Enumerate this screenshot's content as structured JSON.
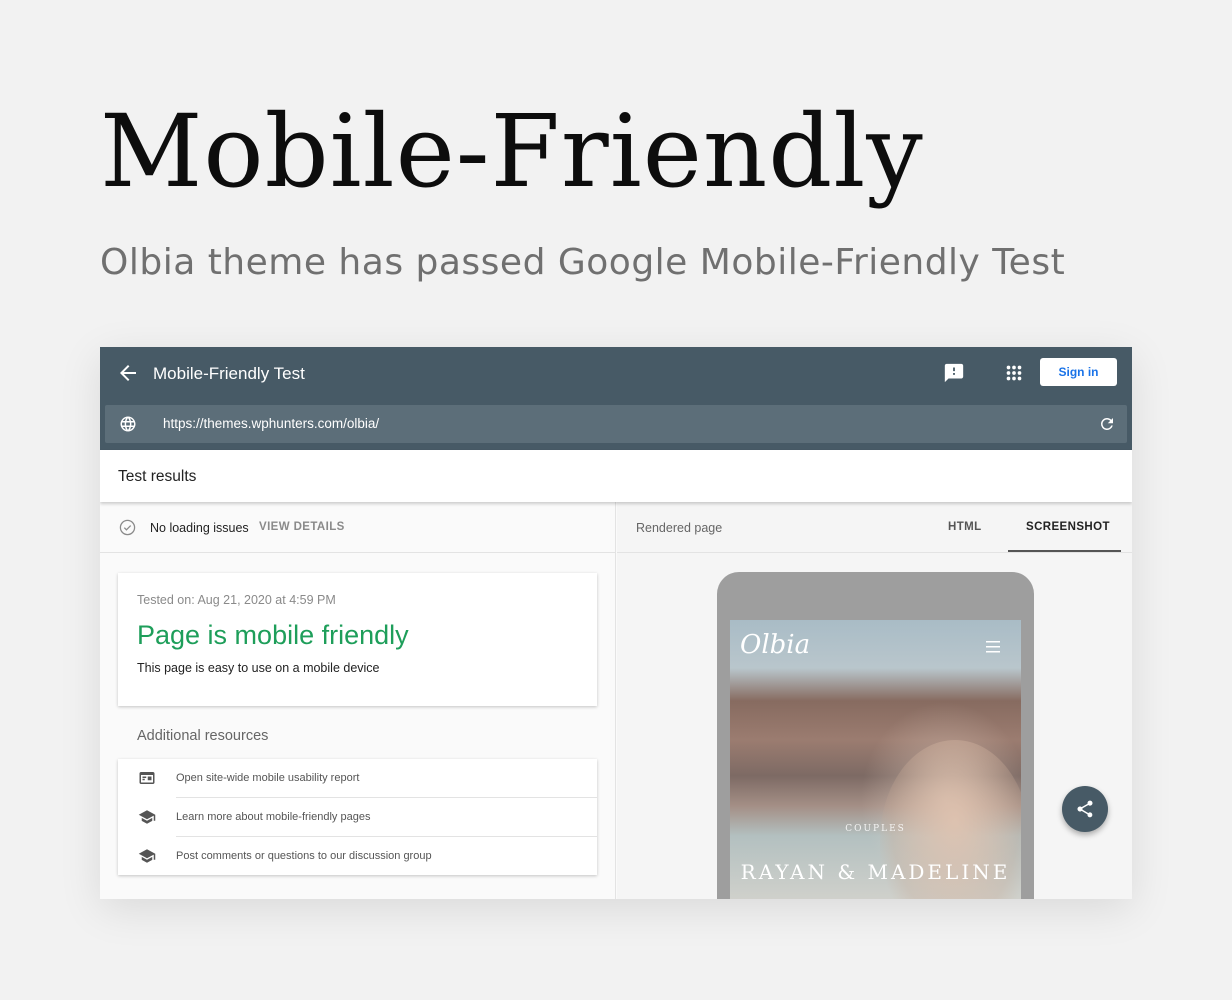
{
  "hero": {
    "title": "Mobile-Friendly",
    "subtitle": "Olbia theme has passed Google Mobile-Friendly Test"
  },
  "appbar": {
    "title": "Mobile-Friendly Test",
    "signin_label": "Sign in",
    "url": "https://themes.wphunters.com/olbia/"
  },
  "results": {
    "title": "Test results",
    "status": "No loading issues",
    "view_details": "VIEW DETAILS",
    "tested_on": "Tested on: Aug 21, 2020 at 4:59 PM",
    "verdict": "Page is mobile friendly",
    "verdict_desc": "This page is easy to use on a mobile device",
    "verdict_color": "#1e9e5a"
  },
  "resources": {
    "title": "Additional resources",
    "items": [
      {
        "label": "Open site-wide mobile usability report",
        "icon": "report-icon"
      },
      {
        "label": "Learn more about mobile-friendly pages",
        "icon": "school-icon"
      },
      {
        "label": "Post comments or questions to our discussion group",
        "icon": "school-icon"
      }
    ]
  },
  "rendered": {
    "label": "Rendered page",
    "tabs": [
      "HTML",
      "SCREENSHOT"
    ],
    "active_tab": "SCREENSHOT"
  },
  "phone": {
    "logo": "Olbia",
    "category": "COUPLES",
    "headline": "RAYAN & MADELINE"
  },
  "colors": {
    "appbar": "#475a66",
    "urlbar": "#5c6e79",
    "accent_blue": "#1a73e8"
  }
}
